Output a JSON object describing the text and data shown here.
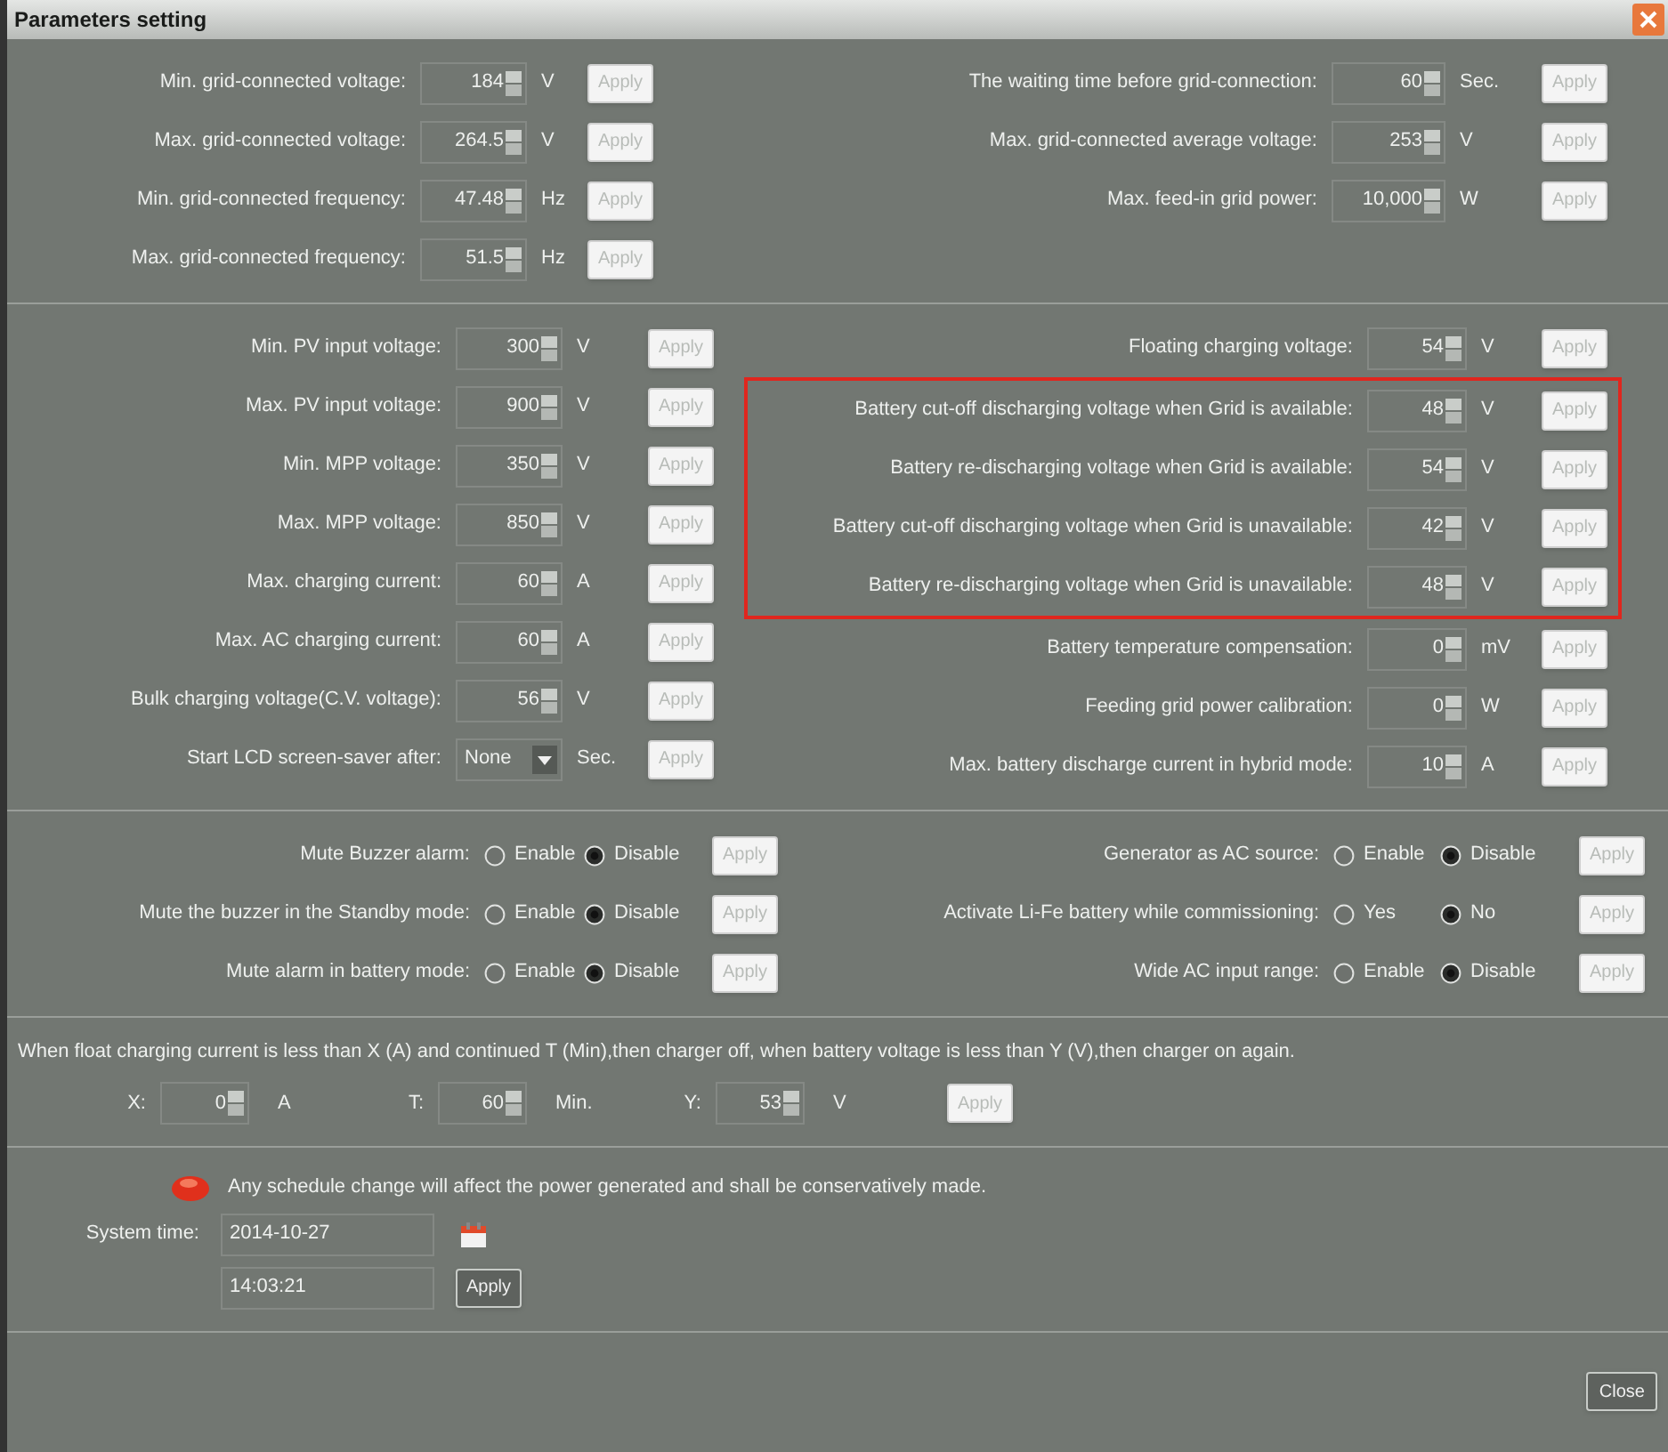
{
  "window": {
    "title": "Parameters setting"
  },
  "grid_section": {
    "left": [
      {
        "kind": "spin",
        "label": "Min. grid-connected voltage:",
        "value": "184",
        "unit": "V",
        "apply": "Apply",
        "apply_disabled": true
      },
      {
        "kind": "spin",
        "label": "Max. grid-connected voltage:",
        "value": "264.5",
        "unit": "V",
        "apply": "Apply",
        "apply_disabled": true
      },
      {
        "kind": "spin",
        "label": "Min. grid-connected frequency:",
        "value": "47.48",
        "unit": "Hz",
        "apply": "Apply",
        "apply_disabled": true
      },
      {
        "kind": "spin",
        "label": "Max. grid-connected frequency:",
        "value": "51.5",
        "unit": "Hz",
        "apply": "Apply",
        "apply_disabled": true
      }
    ],
    "right": [
      {
        "kind": "spin",
        "label": "The waiting time before grid-connection:",
        "value": "60",
        "unit": "Sec.",
        "apply": "Apply",
        "apply_disabled": true
      },
      {
        "kind": "spin",
        "label": "Max. grid-connected average voltage:",
        "value": "253",
        "unit": "V",
        "apply": "Apply",
        "apply_disabled": true
      },
      {
        "kind": "spin",
        "label": "Max. feed-in grid power:",
        "value": "10,000",
        "unit": "W",
        "apply": "Apply",
        "apply_disabled": true
      }
    ]
  },
  "charge_section": {
    "left": [
      {
        "kind": "spin",
        "label": "Min. PV input voltage:",
        "value": "300",
        "unit": "V",
        "apply": "Apply",
        "apply_disabled": true
      },
      {
        "kind": "spin",
        "label": "Max. PV input voltage:",
        "value": "900",
        "unit": "V",
        "apply": "Apply",
        "apply_disabled": true
      },
      {
        "kind": "spin",
        "label": "Min. MPP voltage:",
        "value": "350",
        "unit": "V",
        "apply": "Apply",
        "apply_disabled": true
      },
      {
        "kind": "spin",
        "label": "Max. MPP voltage:",
        "value": "850",
        "unit": "V",
        "apply": "Apply",
        "apply_disabled": true
      },
      {
        "kind": "spin",
        "label": "Max. charging current:",
        "value": "60",
        "unit": "A",
        "apply": "Apply",
        "apply_disabled": true
      },
      {
        "kind": "spin",
        "label": "Max. AC charging current:",
        "value": "60",
        "unit": "A",
        "apply": "Apply",
        "apply_disabled": true
      },
      {
        "kind": "spin",
        "label": "Bulk charging voltage(C.V. voltage):",
        "value": "56",
        "unit": "V",
        "apply": "Apply",
        "apply_disabled": true
      },
      {
        "kind": "dropdown",
        "label": "Start LCD screen-saver after:",
        "value": "None",
        "unit": "Sec.",
        "apply": "Apply",
        "apply_disabled": true
      }
    ],
    "right": [
      {
        "kind": "plain",
        "rows": [
          {
            "kind": "spin",
            "label": "Floating charging voltage:",
            "value": "54",
            "unit": "V",
            "apply": "Apply",
            "apply_disabled": true
          }
        ]
      },
      {
        "kind": "highlighted",
        "rows": [
          {
            "kind": "spin",
            "label": "Battery cut-off discharging voltage when Grid is available:",
            "value": "48",
            "unit": "V",
            "apply": "Apply",
            "apply_disabled": true
          },
          {
            "kind": "spin",
            "label": "Battery re-discharging voltage when Grid is available:",
            "value": "54",
            "unit": "V",
            "apply": "Apply",
            "apply_disabled": true
          },
          {
            "kind": "spin",
            "label": "Battery cut-off discharging voltage when Grid is unavailable:",
            "value": "42",
            "unit": "V",
            "apply": "Apply",
            "apply_disabled": true
          },
          {
            "kind": "spin",
            "label": "Battery re-discharging voltage when Grid is unavailable:",
            "value": "48",
            "unit": "V",
            "apply": "Apply",
            "apply_disabled": true
          }
        ]
      },
      {
        "kind": "plain",
        "rows": [
          {
            "kind": "spin",
            "label": "Battery temperature compensation:",
            "value": "0",
            "unit": "mV",
            "apply": "Apply",
            "apply_disabled": true
          },
          {
            "kind": "spin",
            "label": "Feeding grid power calibration:",
            "value": "0",
            "unit": "W",
            "apply": "Apply",
            "apply_disabled": true
          },
          {
            "kind": "spin",
            "label": "Max. battery discharge current in hybrid mode:",
            "value": "10",
            "unit": "A",
            "apply": "Apply",
            "apply_disabled": true
          }
        ]
      }
    ]
  },
  "options_section": {
    "left": [
      {
        "label": "Mute Buzzer alarm:",
        "options": [
          {
            "label": "Enable",
            "selected": false
          },
          {
            "label": "Disable",
            "selected": true
          }
        ],
        "apply": "Apply",
        "apply_disabled": true
      },
      {
        "label": "Mute the buzzer in the Standby mode:",
        "options": [
          {
            "label": "Enable",
            "selected": false
          },
          {
            "label": "Disable",
            "selected": true
          }
        ],
        "apply": "Apply",
        "apply_disabled": true
      },
      {
        "label": "Mute alarm in battery mode:",
        "options": [
          {
            "label": "Enable",
            "selected": false
          },
          {
            "label": "Disable",
            "selected": true
          }
        ],
        "apply": "Apply",
        "apply_disabled": true
      }
    ],
    "right": [
      {
        "label": "Generator as AC source:",
        "options": [
          {
            "label": "Enable",
            "selected": false
          },
          {
            "label": "Disable",
            "selected": true
          }
        ],
        "apply": "Apply",
        "apply_disabled": true
      },
      {
        "label": "Activate Li-Fe battery while commissioning:",
        "options": [
          {
            "label": "Yes",
            "selected": false
          },
          {
            "label": "No",
            "selected": true
          }
        ],
        "apply": "Apply",
        "apply_disabled": true
      },
      {
        "label": "Wide AC input range:",
        "options": [
          {
            "label": "Enable",
            "selected": false
          },
          {
            "label": "Disable",
            "selected": true
          }
        ],
        "apply": "Apply",
        "apply_disabled": true
      }
    ]
  },
  "float_section": {
    "description": "When float charging current is less than X (A) and continued T (Min),then charger off, when battery voltage is less than Y (V),then charger on again.",
    "fields": [
      {
        "label": "X:",
        "value": "0",
        "unit": "A"
      },
      {
        "label": "T:",
        "value": "60",
        "unit": "Min."
      },
      {
        "label": "Y:",
        "value": "53",
        "unit": "V"
      }
    ],
    "apply": "Apply",
    "apply_disabled": true
  },
  "time_section": {
    "warning": "Any schedule change will affect the power generated and shall be conservatively made.",
    "label": "System time:",
    "date": "2014-10-27",
    "time": "14:03:21",
    "apply": "Apply",
    "apply_disabled": false
  },
  "footer": {
    "close": "Close"
  }
}
